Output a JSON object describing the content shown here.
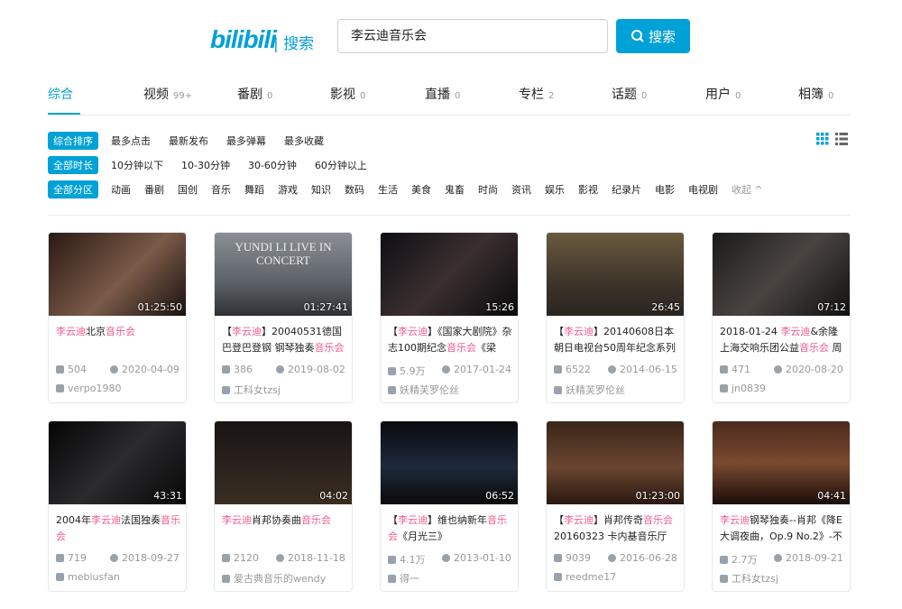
{
  "header": {
    "logo": "bilibili",
    "logo_suffix": "| 搜索",
    "query": "李云迪音乐会",
    "search_label": "搜索"
  },
  "tabs": [
    {
      "label": "综合",
      "count": ""
    },
    {
      "label": "视频",
      "count": "99+"
    },
    {
      "label": "番剧",
      "count": "0"
    },
    {
      "label": "影视",
      "count": "0"
    },
    {
      "label": "直播",
      "count": "0"
    },
    {
      "label": "专栏",
      "count": "2"
    },
    {
      "label": "话题",
      "count": "0"
    },
    {
      "label": "用户",
      "count": "0"
    },
    {
      "label": "相簿",
      "count": "0"
    }
  ],
  "filters": {
    "order": {
      "badge": "综合排序",
      "options": [
        "最多点击",
        "最新发布",
        "最多弹幕",
        "最多收藏"
      ]
    },
    "duration": {
      "badge": "全部时长",
      "options": [
        "10分钟以下",
        "10-30分钟",
        "30-60分钟",
        "60分钟以上"
      ]
    },
    "zone": {
      "badge": "全部分区",
      "options": [
        "动画",
        "番剧",
        "国创",
        "音乐",
        "舞蹈",
        "游戏",
        "知识",
        "数码",
        "生活",
        "美食",
        "鬼畜",
        "时尚",
        "资讯",
        "娱乐",
        "影视",
        "纪录片",
        "电影",
        "电视剧"
      ],
      "collapse": "收起 ^"
    }
  },
  "colors": {
    "accent": "#00a1d6",
    "highlight": "#f25d8e"
  },
  "videos": [
    {
      "duration": "01:25:50",
      "title": [
        {
          "t": "李云迪",
          "h": 1
        },
        {
          "t": "北京"
        },
        {
          "t": "音乐会",
          "h": 1
        }
      ],
      "views": "504",
      "date": "2020-04-09",
      "author": "verpo1980"
    },
    {
      "duration": "01:27:41",
      "thumb_text": "YUNDI LI LIVE IN CONCERT",
      "title": [
        {
          "t": "【"
        },
        {
          "t": "李云迪",
          "h": 1
        },
        {
          "t": "】20040531德国巴登巴登钢 钢琴独奏"
        },
        {
          "t": "音乐会",
          "h": 1
        }
      ],
      "views": "386",
      "date": "2019-08-02",
      "author": "工科女tzsj"
    },
    {
      "duration": "15:26",
      "title": [
        {
          "t": "【"
        },
        {
          "t": "李云迪",
          "h": 1
        },
        {
          "t": "】《国家大剧院》杂志100期纪念"
        },
        {
          "t": "音乐会",
          "h": 1
        },
        {
          "t": "《梁"
        }
      ],
      "views": "5.9万",
      "date": "2017-01-24",
      "author": "妖精芙罗伦丝"
    },
    {
      "duration": "26:45",
      "title": [
        {
          "t": "【"
        },
        {
          "t": "李云迪",
          "h": 1
        },
        {
          "t": "】20140608日本朝日电视台50周年纪念系列"
        }
      ],
      "views": "6522",
      "date": "2014-06-15",
      "author": "妖精芙罗伦丝"
    },
    {
      "duration": "07:12",
      "title": [
        {
          "t": "2018-01-24 "
        },
        {
          "t": "李云迪",
          "h": 1
        },
        {
          "t": "&余隆上海交响乐团公益"
        },
        {
          "t": "音乐会",
          "h": 1
        },
        {
          "t": " 周"
        }
      ],
      "views": "471",
      "date": "2020-08-20",
      "author": "jn0839"
    },
    {
      "duration": "43:31",
      "title": [
        {
          "t": "2004年"
        },
        {
          "t": "李云迪",
          "h": 1
        },
        {
          "t": "法国独奏"
        },
        {
          "t": "音乐会",
          "h": 1
        }
      ],
      "views": "719",
      "date": "2018-09-27",
      "author": "mebiusfan"
    },
    {
      "duration": "04:02",
      "title": [
        {
          "t": "李云迪",
          "h": 1
        },
        {
          "t": "肖邦协奏曲"
        },
        {
          "t": "音乐会",
          "h": 1
        }
      ],
      "views": "2120",
      "date": "2018-11-18",
      "author": "爱古典音乐的wendy"
    },
    {
      "duration": "06:52",
      "title": [
        {
          "t": "【"
        },
        {
          "t": "李云迪",
          "h": 1
        },
        {
          "t": "】维也纳新年"
        },
        {
          "t": "音乐会",
          "h": 1
        },
        {
          "t": "《月光三》"
        }
      ],
      "views": "4.1万",
      "date": "2013-01-10",
      "author": "得一"
    },
    {
      "duration": "01:23:00",
      "title": [
        {
          "t": "【"
        },
        {
          "t": "李云迪",
          "h": 1
        },
        {
          "t": "】肖邦传奇"
        },
        {
          "t": "音乐会",
          "h": 1
        },
        {
          "t": "20160323 卡内基音乐厅"
        }
      ],
      "views": "9039",
      "date": "2016-06-28",
      "author": "reedme17"
    },
    {
      "duration": "04:41",
      "title": [
        {
          "t": "李云迪",
          "h": 1
        },
        {
          "t": "钢琴独奏--肖邦《降E大调夜曲，Op.9 No.2》-不"
        }
      ],
      "views": "2.7万",
      "date": "2018-09-21",
      "author": "工科女tzsj"
    }
  ]
}
